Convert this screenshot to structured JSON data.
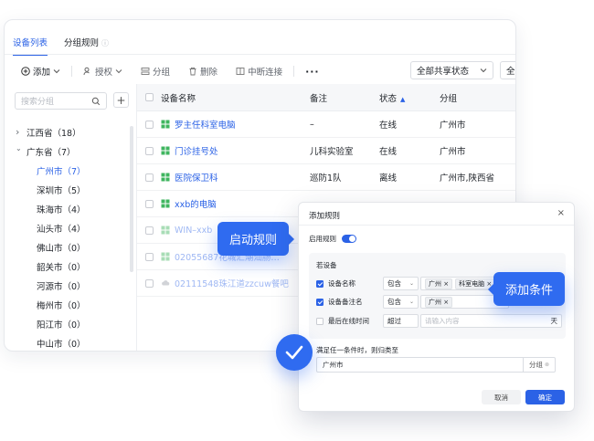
{
  "tabs": [
    {
      "label": "设备列表",
      "active": true
    },
    {
      "label": "分组规则",
      "active": false
    }
  ],
  "toolbar": {
    "add": "添加",
    "authorize": "授权",
    "group": "分组",
    "delete": "删除",
    "disconnect": "中断连接",
    "more": "···",
    "share_filter": "全部共享状态",
    "second_filter": "全"
  },
  "sidebar": {
    "search_placeholder": "搜索分组",
    "tree": [
      {
        "label": "江西省（18）",
        "level": 0,
        "expanded": false
      },
      {
        "label": "广东省（7）",
        "level": 0,
        "expanded": true
      },
      {
        "label": "广州市（7）",
        "level": 1,
        "selected": true
      },
      {
        "label": "深圳市（5）",
        "level": 1
      },
      {
        "label": "珠海市（4）",
        "level": 1
      },
      {
        "label": "汕头市（4）",
        "level": 1
      },
      {
        "label": "佛山市（0）",
        "level": 1
      },
      {
        "label": "韶关市（0）",
        "level": 1
      },
      {
        "label": "河源市（0）",
        "level": 1
      },
      {
        "label": "梅州市（0）",
        "level": 1
      },
      {
        "label": "阳江市（0）",
        "level": 1
      },
      {
        "label": "中山市（0）",
        "level": 1
      }
    ]
  },
  "table": {
    "headers": {
      "name": "设备名称",
      "note": "备注",
      "status": "状态",
      "group": "分组"
    },
    "rows": [
      {
        "name": "罗主任科室电脑",
        "note": "–",
        "status": "在线",
        "group": "广州市",
        "icon": "windows",
        "faded": false
      },
      {
        "name": "门诊挂号处",
        "note": "儿科实验室",
        "status": "在线",
        "group": "广州市",
        "icon": "windows",
        "faded": false
      },
      {
        "name": "医院保卫科",
        "note": "巡防1队",
        "status": "离线",
        "group": "广州市,陕西省",
        "icon": "windows",
        "faded": false
      },
      {
        "name": "xxb的电脑",
        "note": "",
        "status": "",
        "group": "",
        "icon": "windows",
        "faded": false
      },
      {
        "name": "WIN–xxb",
        "note": "",
        "status": "",
        "group": "",
        "icon": "windows",
        "faded": true
      },
      {
        "name": "02055687花城汇潮汕肠…",
        "note": "",
        "status": "",
        "group": "",
        "icon": "windows",
        "faded": true
      },
      {
        "name": "02111548珠江道zzcuw餐吧",
        "note": "",
        "status": "",
        "group": "",
        "icon": "cloud",
        "faded": true
      }
    ]
  },
  "callouts": {
    "start_rule": "启动规则",
    "add_condition": "添加条件"
  },
  "dialog": {
    "title": "添加规则",
    "close": "×",
    "enable_label": "启用规则",
    "cond_title": "若设备",
    "conditions": [
      {
        "label": "设备名称",
        "checked": true,
        "op": "包含",
        "tags": [
          "广州",
          "科室电脑"
        ]
      },
      {
        "label": "设备备注名",
        "checked": true,
        "op": "包含",
        "tags": [
          "广州"
        ]
      },
      {
        "label": "最后在线时间",
        "checked": false,
        "op": "超过",
        "placeholder": "请输入内容",
        "unit": "天"
      }
    ],
    "rule_text": "满足任一条件时，则归类至",
    "rule_value": "广州市",
    "rule_addon": "分组",
    "cancel": "取消",
    "confirm": "确定"
  },
  "colors": {
    "accent": "#2b62e6",
    "callout": "#2f6bf0",
    "windows_icon": "#3fb55f"
  }
}
